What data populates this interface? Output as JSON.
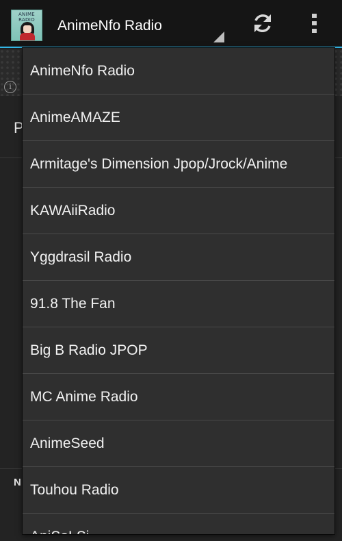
{
  "action_bar": {
    "app_icon_text": "ANIME\nRADIO",
    "selected_station": "AnimeNfo Radio",
    "refresh_icon": "refresh-icon",
    "overflow_icon": "overflow-menu-icon",
    "accent_color": "#33b5e5"
  },
  "background": {
    "partial_letter_top": "P",
    "partial_letter_bottom": "N",
    "info_icon": "info-icon"
  },
  "dropdown": {
    "items": [
      {
        "label": "AnimeNfo Radio"
      },
      {
        "label": "AnimeAMAZE"
      },
      {
        "label": "Armitage's Dimension Jpop/Jrock/Anime"
      },
      {
        "label": "KAWAiiRadio"
      },
      {
        "label": "Yggdrasil Radio"
      },
      {
        "label": "91.8 The Fan"
      },
      {
        "label": "Big B Radio JPOP"
      },
      {
        "label": "MC Anime Radio"
      },
      {
        "label": "AnimeSeed"
      },
      {
        "label": "Touhou Radio"
      },
      {
        "label": "AniSoLSi..."
      }
    ]
  }
}
